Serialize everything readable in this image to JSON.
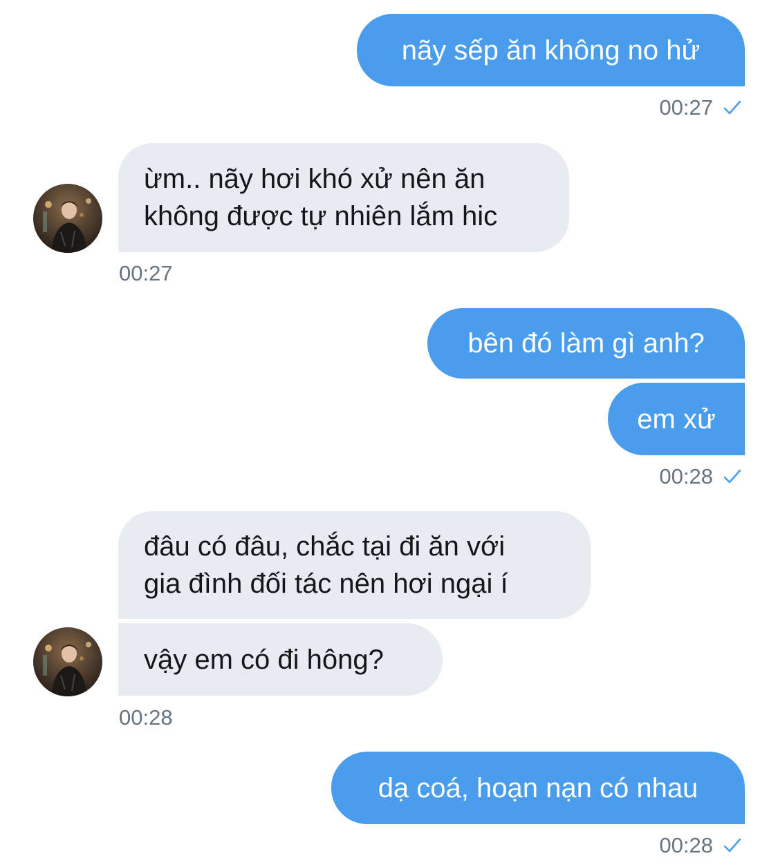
{
  "colors": {
    "outgoing_bubble": "#4a9ded",
    "incoming_bubble": "#e8ebf0",
    "timestamp": "#67737e",
    "read_check": "#4a9ded"
  },
  "messages": {
    "m1": "nãy sếp ăn không no hử",
    "t1": "00:27",
    "m2": "ừm.. nãy hơi khó xử nên ăn\nkhông được tự nhiên lắm hic",
    "t2": "00:27",
    "m3": "bên đó làm gì anh?",
    "m4": "em xử",
    "t3": "00:28",
    "m5": "đâu có đâu, chắc tại đi ăn với\ngia đình đối tác nên hơi ngại í",
    "m6": "vậy em có đi hông?",
    "t4": "00:28",
    "m7": "dạ coá, hoạn nạn có nhau",
    "t5": "00:28"
  },
  "icons": {
    "read_receipt": "check-icon",
    "avatar": "contact-avatar"
  }
}
